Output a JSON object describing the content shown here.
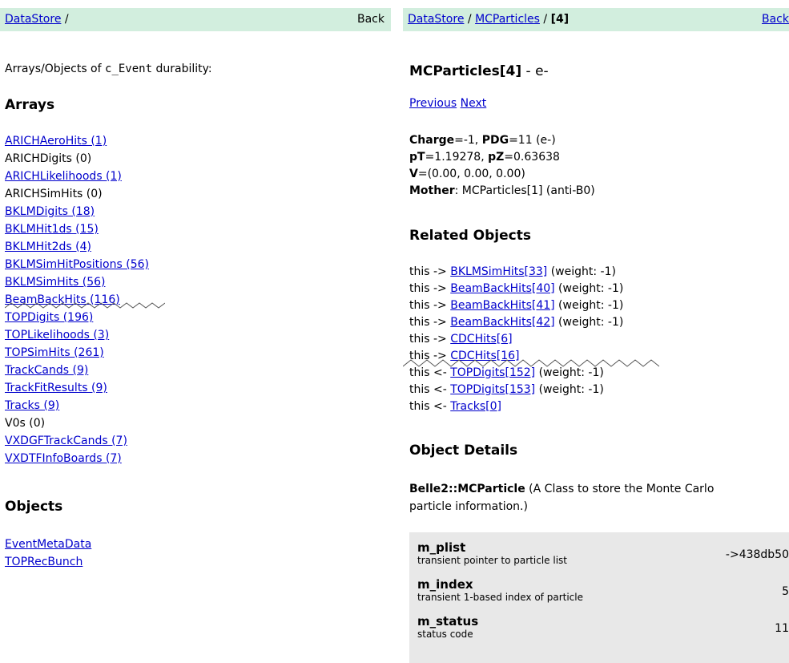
{
  "left": {
    "crumb_link": "DataStore",
    "crumb_sep": " /",
    "back": "Back",
    "intro_prefix": "Arrays/Objects of ",
    "intro_code": "c_Event",
    "intro_suffix": " durability:",
    "arrays_heading": "Arrays",
    "arrays": [
      {
        "label": "ARICHAeroHits (1)",
        "link": true
      },
      {
        "label": "ARICHDigits (0)",
        "link": false
      },
      {
        "label": "ARICHLikelihoods (1)",
        "link": true
      },
      {
        "label": "ARICHSimHits (0)",
        "link": false
      },
      {
        "label": "BKLMDigits (18)",
        "link": true
      },
      {
        "label": "BKLMHit1ds (15)",
        "link": true
      },
      {
        "label": "BKLMHit2ds (4)",
        "link": true
      },
      {
        "label": "BKLMSimHitPositions (56)",
        "link": true
      },
      {
        "label": "BKLMSimHits (56)",
        "link": true
      },
      {
        "label": "BeamBackHits (116)",
        "link": true
      },
      {
        "label": "TOPDigits (196)",
        "link": true
      },
      {
        "label": "TOPLikelihoods (3)",
        "link": true
      },
      {
        "label": "TOPSimHits (261)",
        "link": true
      },
      {
        "label": "TrackCands (9)",
        "link": true
      },
      {
        "label": "TrackFitResults (9)",
        "link": true
      },
      {
        "label": "Tracks (9)",
        "link": true
      },
      {
        "label": "V0s (0)",
        "link": false
      },
      {
        "label": "VXDGFTrackCands (7)",
        "link": true
      },
      {
        "label": "VXDTFInfoBoards (7)",
        "link": true
      }
    ],
    "objects_heading": "Objects",
    "objects": [
      "EventMetaData",
      "TOPRecBunch"
    ]
  },
  "right": {
    "crumb_link1": "DataStore",
    "crumb_sep1": " / ",
    "crumb_link2": "MCParticles",
    "crumb_sep2": " / ",
    "crumb_current": "[4]",
    "back": "Back",
    "title_main": "MCParticles[4]",
    "title_suffix": " - e-",
    "prev": "Previous",
    "next": "Next",
    "props": {
      "charge_label": "Charge",
      "charge_value": "=-1, ",
      "pdg_label": "PDG",
      "pdg_value": "=11 (e-)",
      "pt_label": "pT",
      "pt_value": "=1.19278, ",
      "pz_label": "pZ",
      "pz_value": "=0.63638",
      "v_label": "V",
      "v_value": "=(0.00, 0.00, 0.00)",
      "mother_label": "Mother",
      "mother_value": ": MCParticles[1] (anti-B0)"
    },
    "related_heading": "Related Objects",
    "related": [
      {
        "prefix": "this -> ",
        "link": "BKLMSimHits[33]",
        "suffix": " (weight: -1)"
      },
      {
        "prefix": "this -> ",
        "link": "BeamBackHits[40]",
        "suffix": " (weight: -1)"
      },
      {
        "prefix": "this -> ",
        "link": "BeamBackHits[41]",
        "suffix": " (weight: -1)"
      },
      {
        "prefix": "this -> ",
        "link": "BeamBackHits[42]",
        "suffix": " (weight: -1)"
      },
      {
        "prefix": "this -> ",
        "link": "CDCHits[6]",
        "suffix": ""
      },
      {
        "prefix": "this -> ",
        "link": "CDCHits[16]",
        "suffix": ""
      },
      {
        "prefix": "this <- ",
        "link": "TOPDigits[152]",
        "suffix": " (weight: -1)"
      },
      {
        "prefix": "this <- ",
        "link": "TOPDigits[153]",
        "suffix": " (weight: -1)"
      },
      {
        "prefix": "this <- ",
        "link": "Tracks[0]",
        "suffix": ""
      }
    ],
    "details_heading": "Object Details",
    "class_name": "Belle2::MCParticle",
    "class_desc_line1": " (A Class to store the Monte Carlo",
    "class_desc_line2": "particle information.)",
    "fields": [
      {
        "name": "m_plist",
        "desc": "transient pointer to particle list",
        "value": "->438db50"
      },
      {
        "name": "m_index",
        "desc": "transient 1-based index of particle",
        "value": "5"
      },
      {
        "name": "m_status",
        "desc": "status code",
        "value": "11"
      }
    ]
  }
}
